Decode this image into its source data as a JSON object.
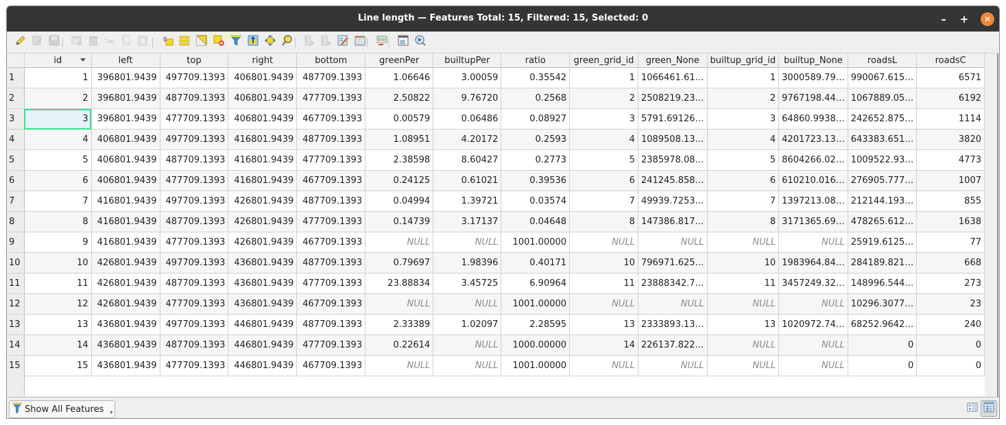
{
  "window": {
    "title": "Line length — Features Total: 15, Filtered: 15, Selected: 0",
    "controls": {
      "minimize": "–",
      "maximize": "+",
      "close": "✕"
    },
    "close_color": "#f0883b"
  },
  "toolbar": {
    "items": [
      {
        "icon": "pencil-icon",
        "label": "Toggle editing mode",
        "enabled": true
      },
      {
        "icon": "multi-edit-icon",
        "label": "Toggle multi edit mode",
        "enabled": false
      },
      {
        "icon": "save-icon",
        "label": "Save edits",
        "enabled": false
      },
      {
        "icon": "add-feature-icon",
        "label": "Add feature",
        "enabled": false
      },
      {
        "icon": "delete-icon",
        "label": "Delete selected features",
        "enabled": false
      },
      {
        "icon": "cut-icon",
        "label": "Cut selected rows",
        "enabled": false
      },
      {
        "icon": "copy-icon",
        "label": "Copy selected rows",
        "enabled": false
      },
      {
        "icon": "paste-icon",
        "label": "Paste features",
        "enabled": false
      },
      {
        "icon": "select-by-expression-icon",
        "label": "Select features using an expression",
        "enabled": true
      },
      {
        "icon": "select-all-icon",
        "label": "Select all",
        "enabled": true
      },
      {
        "icon": "invert-selection-icon",
        "label": "Invert selection",
        "enabled": true
      },
      {
        "icon": "deselect-all-icon",
        "label": "Deselect all",
        "enabled": true
      },
      {
        "icon": "filter-icon",
        "label": "Filter/select features using form",
        "enabled": true
      },
      {
        "icon": "move-selection-top-icon",
        "label": "Move selection to top",
        "enabled": true
      },
      {
        "icon": "pan-to-selection-icon",
        "label": "Pan map to selected rows",
        "enabled": true
      },
      {
        "icon": "zoom-to-selection-icon",
        "label": "Zoom map to selected rows",
        "enabled": true
      },
      {
        "icon": "new-field-icon",
        "label": "New field",
        "enabled": false
      },
      {
        "icon": "delete-field-icon",
        "label": "Delete field",
        "enabled": false
      },
      {
        "icon": "field-calculator-icon",
        "label": "Open field calculator",
        "enabled": true
      },
      {
        "icon": "conditional-formatting-icon",
        "label": "Conditional formatting",
        "enabled": true
      },
      {
        "icon": "actions-icon",
        "label": "Actions",
        "enabled": true
      },
      {
        "icon": "dock-icon",
        "label": "Dock attribute table",
        "enabled": true
      },
      {
        "icon": "organize-columns-icon",
        "label": "Organize columns",
        "enabled": true
      }
    ]
  },
  "table": {
    "columns": [
      "id",
      "left",
      "top",
      "right",
      "bottom",
      "greenPer",
      "builtupPer",
      "ratio",
      "green_grid_id",
      "green_None",
      "builtup_grid_id",
      "builtup_None",
      "roadsL",
      "roadsC"
    ],
    "sorted_column": "id",
    "sort_direction": "descending-indicator",
    "current_cell": {
      "row": 3,
      "column": "id"
    },
    "rows": [
      {
        "n": "1",
        "cells": [
          "1",
          "396801.9439",
          "497709.1393",
          "406801.9439",
          "487709.1393",
          "1.06646",
          "3.00059",
          "0.35542",
          "1",
          "1066461.61…",
          "1",
          "3000589.79…",
          "990067.615…",
          "6571"
        ]
      },
      {
        "n": "2",
        "cells": [
          "2",
          "396801.9439",
          "487709.1393",
          "406801.9439",
          "477709.1393",
          "2.50822",
          "9.76720",
          "0.2568",
          "2",
          "2508219.23…",
          "2",
          "9767198.44…",
          "1067889.05…",
          "6192"
        ]
      },
      {
        "n": "3",
        "cells": [
          "3",
          "396801.9439",
          "477709.1393",
          "406801.9439",
          "467709.1393",
          "0.00579",
          "0.06486",
          "0.08927",
          "3",
          "5791.69126…",
          "3",
          "64860.9938…",
          "242652.875…",
          "1114"
        ]
      },
      {
        "n": "4",
        "cells": [
          "4",
          "406801.9439",
          "497709.1393",
          "416801.9439",
          "487709.1393",
          "1.08951",
          "4.20172",
          "0.2593",
          "4",
          "1089508.13…",
          "4",
          "4201723.13…",
          "643383.651…",
          "3820"
        ]
      },
      {
        "n": "5",
        "cells": [
          "5",
          "406801.9439",
          "487709.1393",
          "416801.9439",
          "477709.1393",
          "2.38598",
          "8.60427",
          "0.2773",
          "5",
          "2385978.08…",
          "5",
          "8604266.02…",
          "1009522.93…",
          "4773"
        ]
      },
      {
        "n": "6",
        "cells": [
          "6",
          "406801.9439",
          "477709.1393",
          "416801.9439",
          "467709.1393",
          "0.24125",
          "0.61021",
          "0.39536",
          "6",
          "241245.858…",
          "6",
          "610210.016…",
          "276905.777…",
          "1007"
        ]
      },
      {
        "n": "7",
        "cells": [
          "7",
          "416801.9439",
          "497709.1393",
          "426801.9439",
          "487709.1393",
          "0.04994",
          "1.39721",
          "0.03574",
          "7",
          "49939.7253…",
          "7",
          "1397213.08…",
          "212144.193…",
          "855"
        ]
      },
      {
        "n": "8",
        "cells": [
          "8",
          "416801.9439",
          "487709.1393",
          "426801.9439",
          "477709.1393",
          "0.14739",
          "3.17137",
          "0.04648",
          "8",
          "147386.817…",
          "8",
          "3171365.69…",
          "478265.612…",
          "1638"
        ]
      },
      {
        "n": "9",
        "cells": [
          "9",
          "416801.9439",
          "477709.1393",
          "426801.9439",
          "467709.1393",
          "NULL",
          "NULL",
          "1001.00000",
          "NULL",
          "NULL",
          "NULL",
          "NULL",
          "25919.6125…",
          "77"
        ]
      },
      {
        "n": "10",
        "cells": [
          "10",
          "426801.9439",
          "497709.1393",
          "436801.9439",
          "487709.1393",
          "0.79697",
          "1.98396",
          "0.40171",
          "10",
          "796971.625…",
          "10",
          "1983964.84…",
          "284189.821…",
          "668"
        ]
      },
      {
        "n": "11",
        "cells": [
          "11",
          "426801.9439",
          "487709.1393",
          "436801.9439",
          "477709.1393",
          "23.88834",
          "3.45725",
          "6.90964",
          "11",
          "23888342.7…",
          "11",
          "3457249.32…",
          "148996.544…",
          "273"
        ]
      },
      {
        "n": "12",
        "cells": [
          "12",
          "426801.9439",
          "477709.1393",
          "436801.9439",
          "467709.1393",
          "NULL",
          "NULL",
          "1001.00000",
          "NULL",
          "NULL",
          "NULL",
          "NULL",
          "10296.3077…",
          "23"
        ]
      },
      {
        "n": "13",
        "cells": [
          "13",
          "436801.9439",
          "497709.1393",
          "446801.9439",
          "487709.1393",
          "2.33389",
          "1.02097",
          "2.28595",
          "13",
          "2333893.13…",
          "13",
          "1020972.74…",
          "68252.9642…",
          "240"
        ]
      },
      {
        "n": "14",
        "cells": [
          "14",
          "436801.9439",
          "487709.1393",
          "446801.9439",
          "477709.1393",
          "0.22614",
          "NULL",
          "1000.00000",
          "14",
          "226137.822…",
          "NULL",
          "NULL",
          "0",
          "0"
        ]
      },
      {
        "n": "15",
        "cells": [
          "15",
          "436801.9439",
          "477709.1393",
          "446801.9439",
          "467709.1393",
          "NULL",
          "NULL",
          "1001.00000",
          "NULL",
          "NULL",
          "NULL",
          "NULL",
          "0",
          "0"
        ]
      }
    ]
  },
  "statusbar": {
    "filter_button_label": "Show All Features",
    "view_buttons": [
      {
        "icon": "form-view-icon",
        "label": "Switch to form view",
        "active": false
      },
      {
        "icon": "table-view-icon",
        "label": "Switch to table view",
        "active": true
      }
    ]
  },
  "colors": {
    "titlebar": "#353535",
    "current_cell_border": "#34e38b",
    "null_text": "#8a8a8a"
  }
}
